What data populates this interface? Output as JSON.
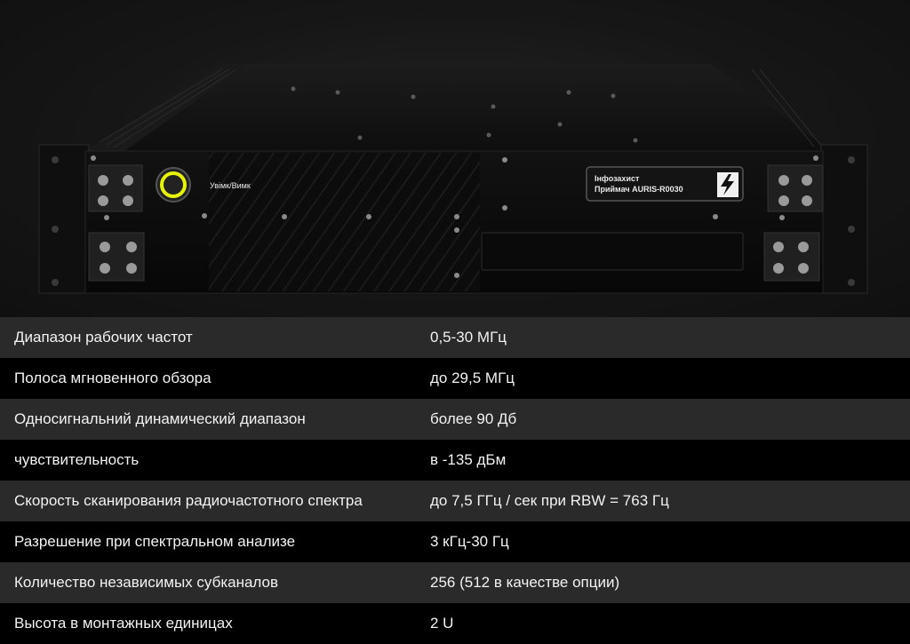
{
  "device": {
    "power_label": "Увімк/Вимк",
    "badge_line1": "Інфозахист",
    "badge_line2": "Приймач AURIS-R0030",
    "colors": {
      "power_ring": "#e6f20a",
      "body": "#0b0b0b",
      "top": "#161616"
    }
  },
  "specs": {
    "rows": [
      {
        "name": "Диапазон рабочих частот",
        "value": "0,5-30 МГц"
      },
      {
        "name": "Полоса мгновенного обзора",
        "value": "до 29,5 МГц"
      },
      {
        "name": "Односигнальний динамический диапазон",
        "value": "более 90 Дб"
      },
      {
        "name": "чувствительность",
        "value": "в -135 дБм"
      },
      {
        "name": "Скорость сканирования радиочастотного спектра",
        "value": "до 7,5 ГГц / сек при RBW = 763 Гц"
      },
      {
        "name": "Разрешение при спектральном анализе",
        "value": "3 кГц-30 Гц"
      },
      {
        "name": "Количество независимых субканалов",
        "value": "256 (512 в качестве опции)"
      },
      {
        "name": "Высота в монтажных единицах",
        "value": "2 U"
      }
    ]
  }
}
